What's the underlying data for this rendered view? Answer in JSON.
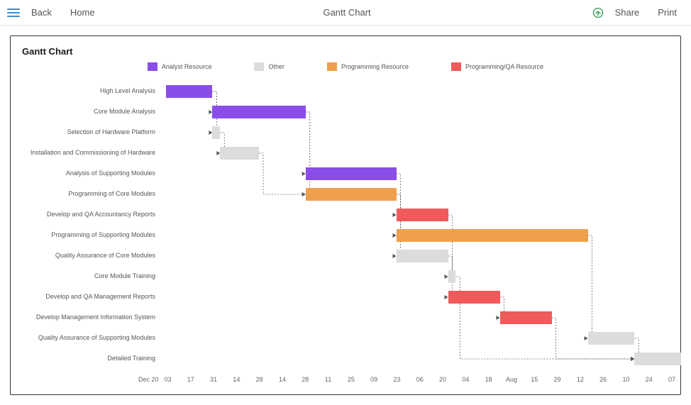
{
  "header": {
    "back": "Back",
    "home": "Home",
    "title": "Gantt Chart",
    "share": "Share",
    "print": "Print"
  },
  "chart_title": "Gantt Chart",
  "legend": [
    {
      "name": "Analyst Resource",
      "color": "#8a4de8"
    },
    {
      "name": "Other",
      "color": "#dcdcdc"
    },
    {
      "name": "Programming Resource",
      "color": "#f0a04c"
    },
    {
      "name": "Programming/QA Resource",
      "color": "#f05a5a"
    }
  ],
  "xaxis": {
    "left_label": "Dec 20",
    "ticks": [
      "03",
      "17",
      "31",
      "14",
      "28",
      "14",
      "28",
      "11",
      "25",
      "09",
      "23",
      "06",
      "20",
      "04",
      "18",
      "Aug",
      "15",
      "29",
      "12",
      "26",
      "10",
      "24",
      "07"
    ]
  },
  "chart_data": {
    "type": "gantt",
    "title": "Gantt Chart",
    "x_unit": "date",
    "x_start": "Dec 20",
    "x_end": "Nov 07 (approx)",
    "categories": [
      "Analyst Resource",
      "Other",
      "Programming Resource",
      "Programming/QA Resource"
    ],
    "category_colors": {
      "Analyst Resource": "#8a4de8",
      "Other": "#dcdcdc",
      "Programming Resource": "#f0a04c",
      "Programming/QA Resource": "#f05a5a"
    },
    "tasks": [
      {
        "id": 1,
        "name": "High Level Analysis",
        "category": "Analyst Resource",
        "start": 0.5,
        "end": 9.5,
        "depends_on": []
      },
      {
        "id": 2,
        "name": "Core Module Analysis",
        "category": "Analyst Resource",
        "start": 9.5,
        "end": 27.5,
        "depends_on": [
          1
        ]
      },
      {
        "id": 3,
        "name": "Selection of Hardware Platform",
        "category": "Other",
        "start": 9.5,
        "end": 11,
        "depends_on": [
          1
        ]
      },
      {
        "id": 4,
        "name": "Installation and Commissioning of Hardware",
        "category": "Other",
        "start": 11,
        "end": 18.5,
        "depends_on": [
          3
        ]
      },
      {
        "id": 5,
        "name": "Analysis of Supporting Modules",
        "category": "Analyst Resource",
        "start": 27.5,
        "end": 45,
        "depends_on": [
          2
        ]
      },
      {
        "id": 6,
        "name": "Programming of Core Modules",
        "category": "Programming Resource",
        "start": 27.5,
        "end": 45,
        "depends_on": [
          2,
          4
        ]
      },
      {
        "id": 7,
        "name": "Develop and QA Accountancy Reports",
        "category": "Programming/QA Resource",
        "start": 45,
        "end": 55,
        "depends_on": [
          6
        ]
      },
      {
        "id": 8,
        "name": "Programming of Supporting Modules",
        "category": "Programming Resource",
        "start": 45,
        "end": 82,
        "depends_on": [
          5,
          6
        ]
      },
      {
        "id": 9,
        "name": "Quality Assurance of Core Modules",
        "category": "Other",
        "start": 45,
        "end": 55,
        "depends_on": [
          6
        ]
      },
      {
        "id": 10,
        "name": "Core Module Training",
        "category": "Other",
        "start": 55,
        "end": 56.5,
        "depends_on": [
          9
        ]
      },
      {
        "id": 11,
        "name": "Develop and QA Management Reports",
        "category": "Programming/QA Resource",
        "start": 55,
        "end": 65,
        "depends_on": [
          7
        ]
      },
      {
        "id": 12,
        "name": "Develop Management Information System",
        "category": "Programming/QA Resource",
        "start": 65,
        "end": 75,
        "depends_on": [
          11
        ]
      },
      {
        "id": 13,
        "name": "Quality Assurance of Supporting Modules",
        "category": "Other",
        "start": 82,
        "end": 91,
        "depends_on": [
          8
        ]
      },
      {
        "id": 14,
        "name": "Detailed Training",
        "category": "Other",
        "start": 91,
        "end": 100,
        "depends_on": [
          10,
          12,
          13
        ]
      }
    ],
    "x_scale_note": "start/end are % of the full plotted timeline (Dec 20 → early Nov)"
  }
}
